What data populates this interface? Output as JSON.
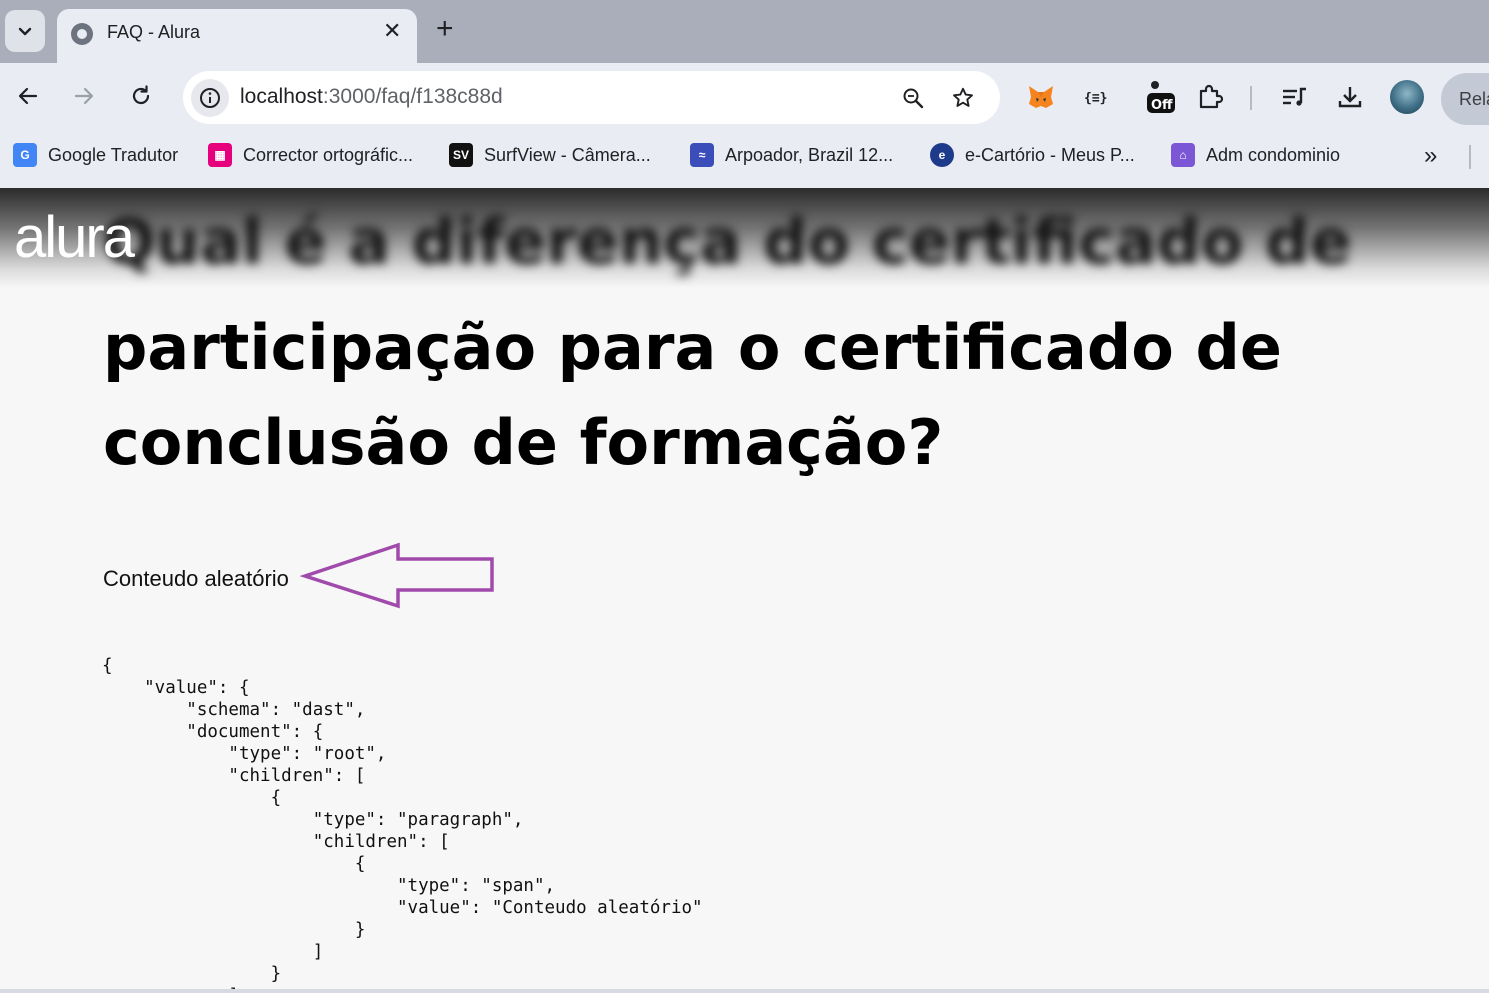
{
  "browser": {
    "tab": {
      "title": "FAQ - Alura",
      "close": "✕"
    },
    "new_tab": "+",
    "url": {
      "host": "localhost",
      "rest": ":3000/faq/f138c88d"
    },
    "relaunch_label": "Rela",
    "bookmarks": [
      {
        "label": "Google Tradutor",
        "icon": "google-translate-icon",
        "color": "#4285f4"
      },
      {
        "label": "Corrector ortográfic...",
        "icon": "corrector-icon",
        "color": "#e6007e"
      },
      {
        "label": "SurfView - Câmera...",
        "icon": "surfview-icon",
        "color": "#111111"
      },
      {
        "label": "Arpoador, Brazil 12...",
        "icon": "arpoador-icon",
        "color": "#3b4db8"
      },
      {
        "label": "e-Cartório - Meus P...",
        "icon": "ecartorio-icon",
        "color": "#1e3a8a"
      },
      {
        "label": "Adm condominio",
        "icon": "condominio-icon",
        "color": "#7b57d6"
      }
    ],
    "bookmarks_more": "»"
  },
  "page": {
    "logo": "alura",
    "heading_first_line_blurred": "Qual é a diferença do certificado de",
    "heading_rest": "participação para o certificado de conclusão de formação?",
    "content_text": "Conteudo aleatório",
    "arrow_color": "#a04aab",
    "code_block": "{\n    \"value\": {\n        \"schema\": \"dast\",\n        \"document\": {\n            \"type\": \"root\",\n            \"children\": [\n                {\n                    \"type\": \"paragraph\",\n                    \"children\": [\n                        {\n                            \"type\": \"span\",\n                            \"value\": \"Conteudo aleatório\"\n                        }\n                    ]\n                }\n            ]"
  }
}
